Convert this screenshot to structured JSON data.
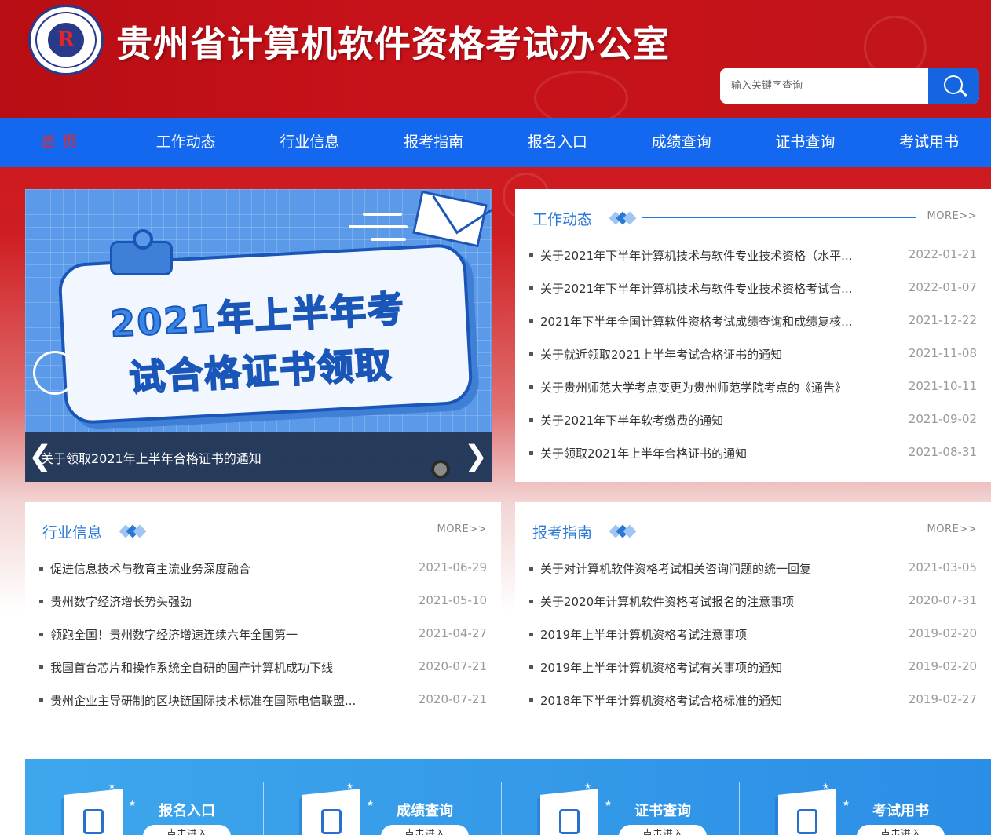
{
  "header": {
    "site_title": "贵州省计算机软件资格考试办公室",
    "logo_letter": "R",
    "search_placeholder": "输入关键字查询"
  },
  "nav": {
    "items": [
      {
        "label": "首页",
        "active": true
      },
      {
        "label": "工作动态",
        "active": false
      },
      {
        "label": "行业信息",
        "active": false
      },
      {
        "label": "报考指南",
        "active": false
      },
      {
        "label": "报名入口",
        "active": false
      },
      {
        "label": "成绩查询",
        "active": false
      },
      {
        "label": "证书查询",
        "active": false
      },
      {
        "label": "考试用书",
        "active": false
      }
    ]
  },
  "slider": {
    "image_line1": "2021年上半年考",
    "image_line2": "试合格证书领取",
    "caption": "关于领取2021年上半年合格证书的通知",
    "prev": "❮",
    "next": "❯"
  },
  "work_news": {
    "title": "工作动态",
    "more": "MORE>>",
    "items": [
      {
        "title": "关于2021年下半年计算机技术与软件专业技术资格（水平...",
        "date": "2022-01-21"
      },
      {
        "title": "关于2021年下半年计算机技术与软件专业技术资格考试合...",
        "date": "2022-01-07"
      },
      {
        "title": "2021年下半年全国计算软件资格考试成绩查询和成绩复核...",
        "date": "2021-12-22"
      },
      {
        "title": "关于就近领取2021上半年考试合格证书的通知",
        "date": "2021-11-08"
      },
      {
        "title": "关于贵州师范大学考点变更为贵州师范学院考点的《通告》",
        "date": "2021-10-11"
      },
      {
        "title": "关于2021年下半年软考缴费的通知",
        "date": "2021-09-02"
      },
      {
        "title": "关于领取2021年上半年合格证书的通知",
        "date": "2021-08-31"
      }
    ]
  },
  "industry_news": {
    "title": "行业信息",
    "more": "MORE>>",
    "items": [
      {
        "title": "促进信息技术与教育主流业务深度融合",
        "date": "2021-06-29"
      },
      {
        "title": "贵州数字经济增长势头强劲",
        "date": "2021-05-10"
      },
      {
        "title": "领跑全国！贵州数字经济增速连续六年全国第一",
        "date": "2021-04-27"
      },
      {
        "title": "我国首台芯片和操作系统全自研的国产计算机成功下线",
        "date": "2020-07-21"
      },
      {
        "title": "贵州企业主导研制的区块链国际技术标准在国际电信联盟...",
        "date": "2020-07-21"
      }
    ]
  },
  "guide_news": {
    "title": "报考指南",
    "more": "MORE>>",
    "items": [
      {
        "title": "关于对计算机软件资格考试相关咨询问题的统一回复",
        "date": "2021-03-05"
      },
      {
        "title": "关于2020年计算机软件资格考试报名的注意事项",
        "date": "2020-07-31"
      },
      {
        "title": "2019年上半年计算机资格考试注意事项",
        "date": "2019-02-20"
      },
      {
        "title": "2019年上半年计算机资格考试有关事项的通知",
        "date": "2019-02-20"
      },
      {
        "title": "2018年下半年计算机资格考试合格标准的通知",
        "date": "2019-02-27"
      }
    ]
  },
  "quick_links": {
    "items": [
      {
        "label": "报名入口",
        "button": "点击进入",
        "icon": "pen-icon"
      },
      {
        "label": "成绩查询",
        "button": "点击进入",
        "icon": "document-search-icon"
      },
      {
        "label": "证书查询",
        "button": "点击进入",
        "icon": "certificate-search-icon"
      },
      {
        "label": "考试用书",
        "button": "点击进入",
        "icon": "book-icon"
      }
    ]
  },
  "colors": {
    "header_red": "#c8121a",
    "nav_blue": "#1368ef",
    "active_nav": "#e52a2a",
    "panel_title_blue": "#2a79d6"
  }
}
